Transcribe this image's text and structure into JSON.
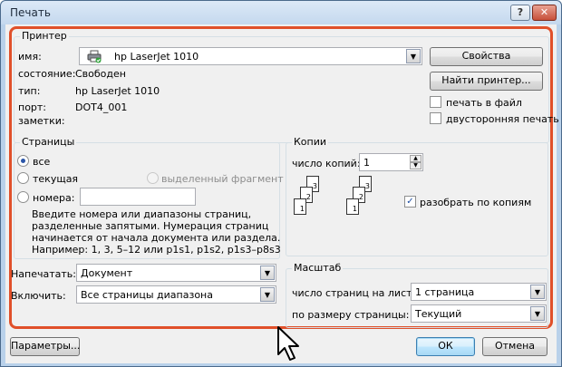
{
  "window": {
    "title": "Печать",
    "help_label": "?",
    "close_label": "✕"
  },
  "printer": {
    "legend": "Принтер",
    "name_label": "имя:",
    "name_value": "hp LaserJet 1010",
    "status_label": "состояние:",
    "status_value": "Свободен",
    "type_label": "тип:",
    "type_value": "hp LaserJet 1010",
    "port_label": "порт:",
    "port_value": "DOT4_001",
    "notes_label": "заметки:",
    "properties_button": "Свойства",
    "find_button": "Найти принтер...",
    "print_to_file": "печать в файл",
    "duplex": "двусторонняя печать",
    "icon": "printer-icon"
  },
  "pages": {
    "legend": "Страницы",
    "all": "все",
    "current": "текущая",
    "selection": "выделенный фрагмент",
    "numbers": "номера:",
    "numbers_value": "",
    "hint": [
      "Введите номера или диапазоны страниц,",
      "разделенные запятыми. Нумерация страниц",
      "начинается от начала документа или раздела.",
      "Например: 1, 3, 5–12 или p1s1, p1s2, p1s3–p8s3"
    ]
  },
  "print_what": {
    "label": "Напечатать:",
    "value": "Документ"
  },
  "include": {
    "label": "Включить:",
    "value": "Все страницы диапазона"
  },
  "copies": {
    "legend": "Копии",
    "count_label": "число копий:",
    "count_value": "1",
    "collate": "разобрать по копиям",
    "collate_checked": true,
    "page_numbers": [
      "1",
      "2",
      "3"
    ]
  },
  "zoom": {
    "legend": "Масштаб",
    "pages_per_sheet_label": "число страниц на листе:",
    "pages_per_sheet_value": "1 страница",
    "scale_label": "по размеру страницы:",
    "scale_value": "Текущий"
  },
  "footer": {
    "options_button": "Параметры...",
    "ok_button": "ОК",
    "cancel_button": "Отмена"
  },
  "colors": {
    "highlight": "#e0502a",
    "dialog_bg": "#f0f0f0",
    "frame": "#b9d1ea"
  }
}
